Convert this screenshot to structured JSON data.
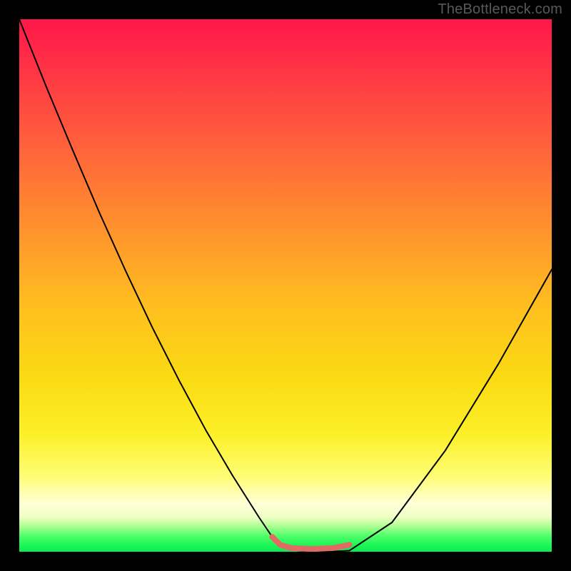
{
  "watermark": "TheBottleneck.com",
  "chart_data": {
    "type": "line",
    "title": "",
    "xlabel": "",
    "ylabel": "",
    "xlim": [
      0,
      1
    ],
    "ylim": [
      0,
      1
    ],
    "series": [
      {
        "name": "main-curve",
        "x": [
          0.0,
          0.05,
          0.1,
          0.15,
          0.2,
          0.25,
          0.3,
          0.35,
          0.4,
          0.45,
          0.475,
          0.5,
          0.525,
          0.55,
          0.58,
          0.62,
          0.7,
          0.8,
          0.9,
          1.0
        ],
        "y": [
          1.0,
          0.875,
          0.755,
          0.638,
          0.527,
          0.421,
          0.322,
          0.229,
          0.144,
          0.065,
          0.028,
          0.009,
          0.002,
          0.0,
          0.0,
          0.002,
          0.055,
          0.19,
          0.353,
          0.53
        ]
      },
      {
        "name": "plateau-marker",
        "x": [
          0.475,
          0.49,
          0.51,
          0.55,
          0.59,
          0.62
        ],
        "y": [
          0.028,
          0.013,
          0.007,
          0.005,
          0.007,
          0.013
        ]
      }
    ],
    "colors": {
      "curve": "#000000",
      "marker": "#e26a65",
      "frame": "#000000"
    }
  }
}
